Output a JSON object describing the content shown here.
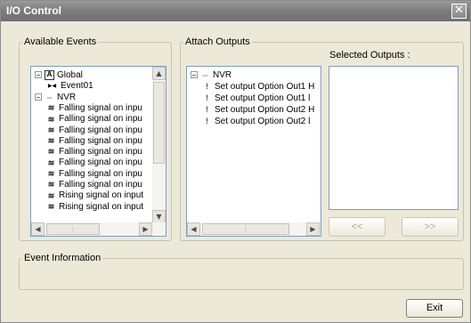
{
  "window": {
    "title": "I/O Control",
    "close_glyph": "✕"
  },
  "available_events": {
    "legend": "Available Events",
    "tree": [
      {
        "label": "Global",
        "expander": "−",
        "icon": "global-icon",
        "indent": 0
      },
      {
        "label": "Event01",
        "icon": "event-icon",
        "indent": 1
      },
      {
        "label": "NVR",
        "expander": "−",
        "icon": "nvr-icon",
        "indent": 0
      },
      {
        "label": "Falling signal on inpu",
        "icon": "signal-icon",
        "indent": 1
      },
      {
        "label": "Falling signal on inpu",
        "icon": "signal-icon",
        "indent": 1
      },
      {
        "label": "Falling signal on inpu",
        "icon": "signal-icon",
        "indent": 1
      },
      {
        "label": "Falling signal on inpu",
        "icon": "signal-icon",
        "indent": 1
      },
      {
        "label": "Falling signal on inpu",
        "icon": "signal-icon",
        "indent": 1
      },
      {
        "label": "Falling signal on inpu",
        "icon": "signal-icon",
        "indent": 1
      },
      {
        "label": "Falling signal on inpu",
        "icon": "signal-icon",
        "indent": 1
      },
      {
        "label": "Falling signal on inpu",
        "icon": "signal-icon",
        "indent": 1
      },
      {
        "label": "Rising signal on input",
        "icon": "signal-icon",
        "indent": 1
      },
      {
        "label": "Rising signal on input",
        "icon": "signal-icon",
        "indent": 1
      }
    ]
  },
  "attach_outputs": {
    "legend": "Attach Outputs",
    "selected_label": "Selected Outputs :",
    "tree": [
      {
        "label": "NVR",
        "expander": "−",
        "icon": "nvr-icon",
        "indent": 0
      },
      {
        "label": "Set output Option Out1 H",
        "icon": "output-icon",
        "indent": 1
      },
      {
        "label": "Set output Option Out1 l",
        "icon": "output-icon",
        "indent": 1
      },
      {
        "label": "Set output Option Out2 H",
        "icon": "output-icon",
        "indent": 1
      },
      {
        "label": "Set output Option Out2 l",
        "icon": "output-icon",
        "indent": 1
      }
    ],
    "remove_button": "<<",
    "add_button": ">>"
  },
  "event_information": {
    "legend": "Event Information"
  },
  "exit_button": "Exit",
  "glyphs": {
    "up": "▲",
    "down": "▼",
    "left": "◀",
    "right": "▶",
    "grip": "⋮"
  }
}
